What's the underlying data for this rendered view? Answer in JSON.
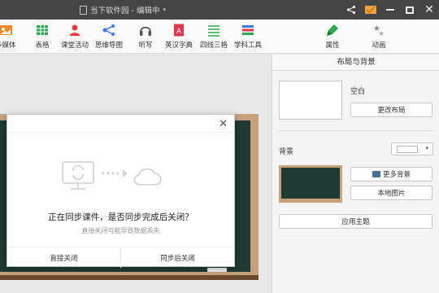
{
  "titlebar": {
    "doc_title": "当下软件园 - 编辑中",
    "icons": [
      "share-icon",
      "mail-icon",
      "minimize-icon",
      "maximize-icon",
      "close-icon"
    ]
  },
  "toolbar": {
    "items": [
      {
        "label": "多媒体",
        "icon": "media-icon"
      },
      {
        "label": "表格",
        "icon": "table-icon"
      },
      {
        "label": "课堂活动",
        "icon": "classroom-icon"
      },
      {
        "label": "思维导图",
        "icon": "mindmap-icon"
      },
      {
        "label": "听写",
        "icon": "headphone-icon"
      },
      {
        "label": "英汉字典",
        "icon": "dictionary-icon"
      },
      {
        "label": "四线三格",
        "icon": "lines-icon"
      },
      {
        "label": "学科工具",
        "icon": "books-icon"
      }
    ],
    "right_tabs": [
      {
        "label": "属性",
        "icon": "brush-icon"
      },
      {
        "label": "动画",
        "icon": "stars-icon"
      }
    ]
  },
  "panel": {
    "title": "布局与背景",
    "blank_label": "空白",
    "change_layout": "更改布局",
    "background_label": "背景",
    "more_bg": "更多背景",
    "local_image": "本地图片",
    "apply_theme": "应用主题"
  },
  "dialog": {
    "message": "正在同步课件，是否同步完成后关闭？",
    "sub": "直接关闭可能导致数据丢失",
    "close_now": "直接关闭",
    "close_after_sync": "同步后关闭"
  },
  "colors": {
    "titlebar": "#454545",
    "board": "#1e3a32",
    "frame": "#c6a17c",
    "mail": "#f3a13a"
  }
}
